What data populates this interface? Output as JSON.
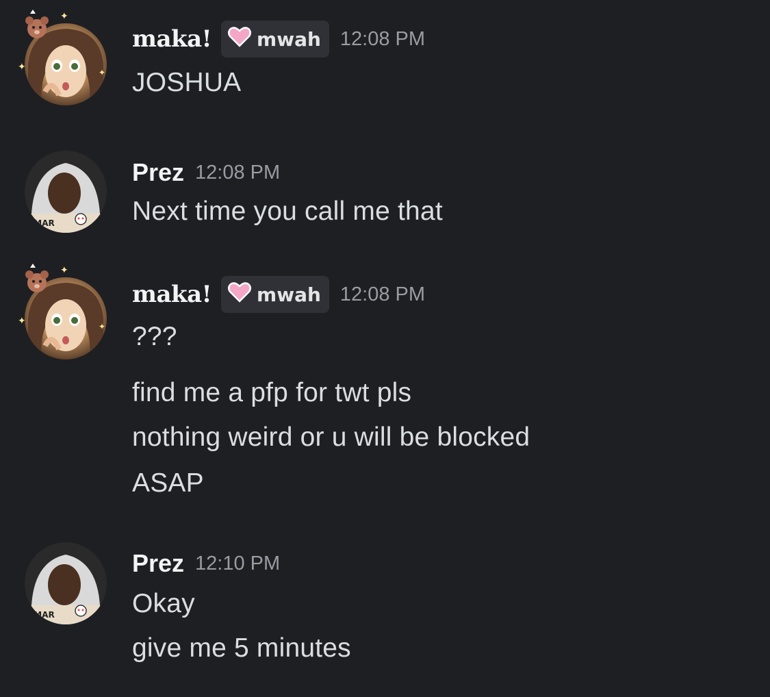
{
  "messages": [
    {
      "author": "maka!",
      "tag": "mwah",
      "time": "12:08 PM",
      "lines": [
        "JOSHUA"
      ]
    },
    {
      "author": "Prez",
      "time": "12:08 PM",
      "lines": [
        "Next time you call me that"
      ]
    },
    {
      "author": "maka!",
      "tag": "mwah",
      "time": "12:08 PM",
      "lines": [
        "???",
        "find me a pfp for twt pls",
        "nothing weird or u will be blocked",
        "ASAP"
      ]
    },
    {
      "author": "Prez",
      "time": "12:10 PM",
      "lines": [
        "Okay",
        "give me 5 minutes"
      ]
    }
  ],
  "avatar_overlay_text": "AMAR",
  "colors": {
    "background": "#1e1f22",
    "username": "#f2f3f5",
    "message": "#dbdee1",
    "timestamp": "#9a9ca3",
    "tag_background": "#2f3136",
    "heart": "#f4a6c6"
  },
  "icons": {
    "tag_icon": "pink-heart-icon",
    "avatar_decoration": "bear-sparkle-decoration"
  }
}
